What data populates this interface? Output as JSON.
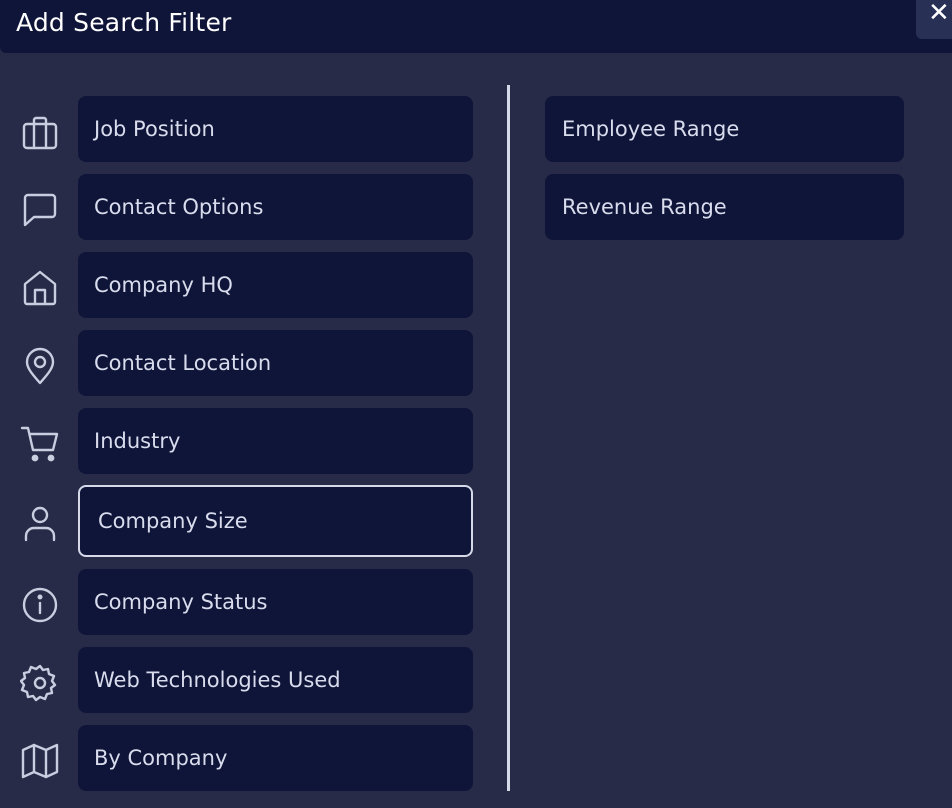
{
  "modal": {
    "title": "Add Search Filter",
    "close_label": "✕"
  },
  "categories": [
    {
      "label": "Job Position",
      "icon": "briefcase-icon"
    },
    {
      "label": "Contact Options",
      "icon": "chat-bubble-icon"
    },
    {
      "label": "Company HQ",
      "icon": "home-icon"
    },
    {
      "label": "Contact Location",
      "icon": "map-pin-icon"
    },
    {
      "label": "Industry",
      "icon": "shopping-cart-icon"
    },
    {
      "label": "Company Size",
      "icon": "user-icon",
      "selected": true
    },
    {
      "label": "Company Status",
      "icon": "info-icon"
    },
    {
      "label": "Web Technologies Used",
      "icon": "gear-icon"
    },
    {
      "label": "By Company",
      "icon": "map-icon"
    }
  ],
  "sub_filters": [
    {
      "label": "Employee Range"
    },
    {
      "label": "Revenue Range"
    }
  ],
  "colors": {
    "background": "#282b48",
    "panel": "#0f1539",
    "text": "#d9dcec",
    "accent": "#d6d9e8"
  }
}
